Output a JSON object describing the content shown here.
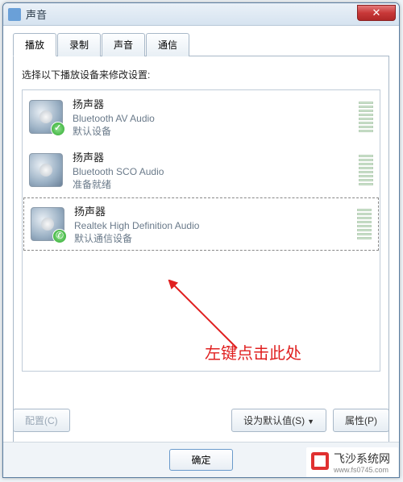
{
  "window": {
    "title": "声音"
  },
  "tabs": [
    {
      "label": "播放"
    },
    {
      "label": "录制"
    },
    {
      "label": "声音"
    },
    {
      "label": "通信"
    }
  ],
  "instruction": "选择以下播放设备来修改设置:",
  "devices": [
    {
      "name": "扬声器",
      "sub": "Bluetooth AV Audio",
      "status": "默认设备",
      "badge": "check"
    },
    {
      "name": "扬声器",
      "sub": "Bluetooth SCO Audio",
      "status": "准备就绪",
      "badge": ""
    },
    {
      "name": "扬声器",
      "sub": "Realtek High Definition Audio",
      "status": "默认通信设备",
      "badge": "phone"
    }
  ],
  "buttons": {
    "configure": "配置(C)",
    "setdefault": "设为默认值(S)",
    "properties": "属性(P)",
    "ok": "确定"
  },
  "annotation": "左键点击此处",
  "watermark": {
    "name": "飞沙系统网",
    "url": "www.fs0745.com"
  }
}
